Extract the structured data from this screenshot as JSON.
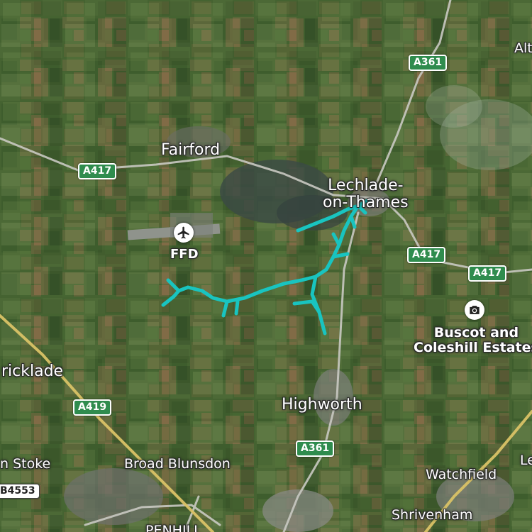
{
  "map": {
    "style": "satellite",
    "colors": {
      "route": "#19c4c0",
      "road_shield_bg": "#2f8c4e",
      "label_text": "#ffffff"
    },
    "places": {
      "fairford": "Fairford",
      "lechlade_line1": "Lechlade-",
      "lechlade_line2": "on-Thames",
      "highworth": "Highworth",
      "cricklade": "ricklade",
      "broad_blunsdon": "Broad Blunsdon",
      "stoke": "n Stoke",
      "watchfield": "Watchfield",
      "shrivenham": "Shrivenham",
      "penhill": "PENHILL",
      "alt": "Alt",
      "le": "Le"
    },
    "airport": {
      "code": "FFD",
      "icon": "airplane-icon"
    },
    "poi": {
      "icon": "camera-icon",
      "name_line1": "Buscot and",
      "name_line2": "Coleshill Estates"
    },
    "roads": {
      "a361_north": "A361",
      "a417_west": "A417",
      "a417_east1": "A417",
      "a417_east2": "A417",
      "a419": "A419",
      "a361_south": "A361",
      "b4553": "B4553"
    }
  }
}
